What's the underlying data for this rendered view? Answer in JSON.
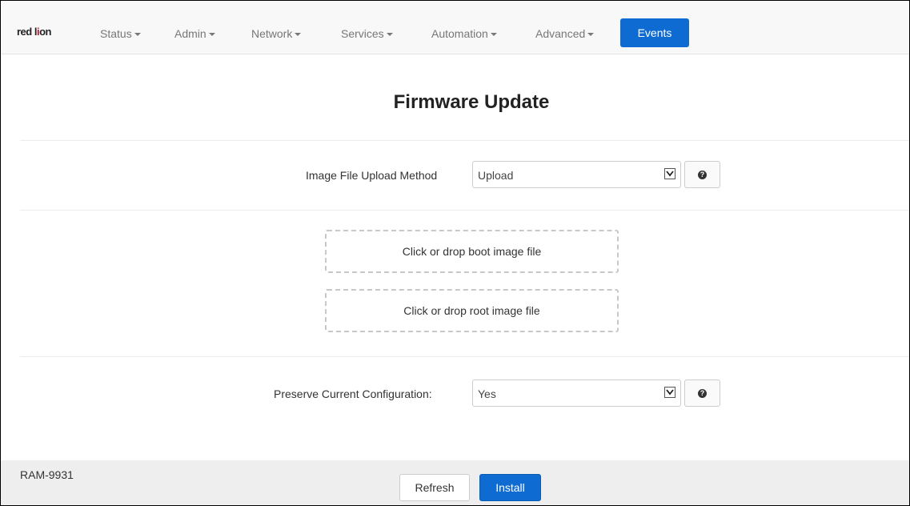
{
  "navbar": {
    "logo_prefix": "red l",
    "logo_mark": "i",
    "logo_suffix": "on",
    "items": [
      {
        "label": "Status"
      },
      {
        "label": "Admin"
      },
      {
        "label": "Network"
      },
      {
        "label": "Services"
      },
      {
        "label": "Automation"
      },
      {
        "label": "Advanced"
      }
    ],
    "active_item": "Events"
  },
  "page": {
    "title": "Firmware Update"
  },
  "upload_method": {
    "label": "Image File Upload Method",
    "value": "Upload",
    "help_icon": "question-circle-icon"
  },
  "dropzones": {
    "boot": "Click or drop boot image file",
    "root": "Click or drop root image file"
  },
  "preserve_config": {
    "label": "Preserve Current Configuration:",
    "value": "Yes",
    "help_icon": "question-circle-icon"
  },
  "footer": {
    "device_name": "RAM-9931",
    "refresh_label": "Refresh",
    "install_label": "Install"
  },
  "colors": {
    "accent": "#0d6bd2",
    "navbar_bg": "#f8f8f8",
    "footer_bg": "#eeeeee"
  }
}
